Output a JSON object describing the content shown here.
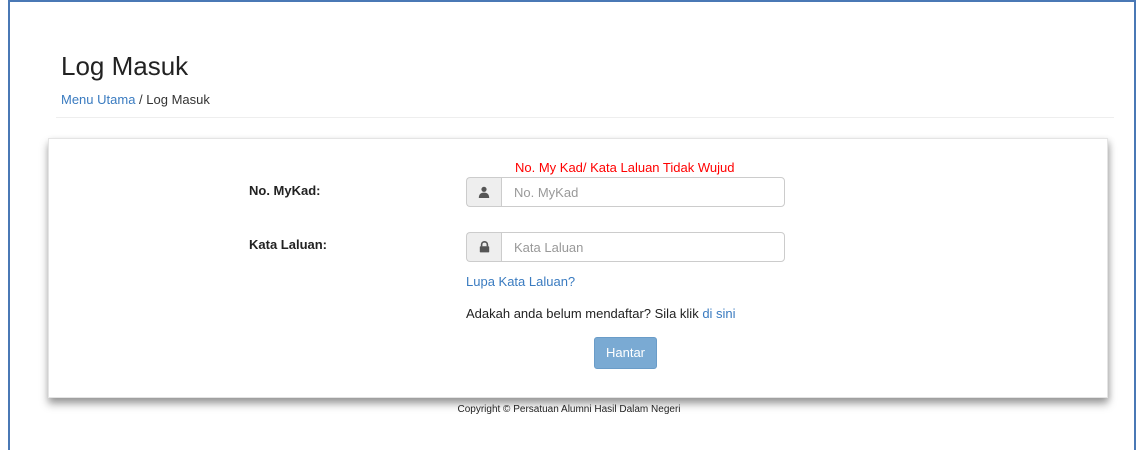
{
  "page": {
    "title": "Log Masuk"
  },
  "breadcrumb": {
    "home": "Menu Utama",
    "separator": " / ",
    "current": "Log Masuk"
  },
  "form": {
    "error": "No. My Kad/ Kata Laluan Tidak Wujud",
    "mykad": {
      "label": "No. MyKad:",
      "placeholder": "No. MyKad",
      "value": "",
      "icon": "user-icon"
    },
    "password": {
      "label": "Kata Laluan:",
      "placeholder": "Kata Laluan",
      "value": "",
      "icon": "lock-icon"
    },
    "forgot_link": "Lupa Kata Laluan?",
    "register_prompt": "Adakah anda belum mendaftar? Sila klik ",
    "register_link": "di sini",
    "submit_label": "Hantar"
  },
  "footer": {
    "copyright": "Copyright © Persatuan Alumni Hasil Dalam Negeri"
  },
  "colors": {
    "link": "#3a7bc0",
    "error": "#ff0000",
    "button": "#7aaad3",
    "frame_border": "#4a78b5"
  }
}
